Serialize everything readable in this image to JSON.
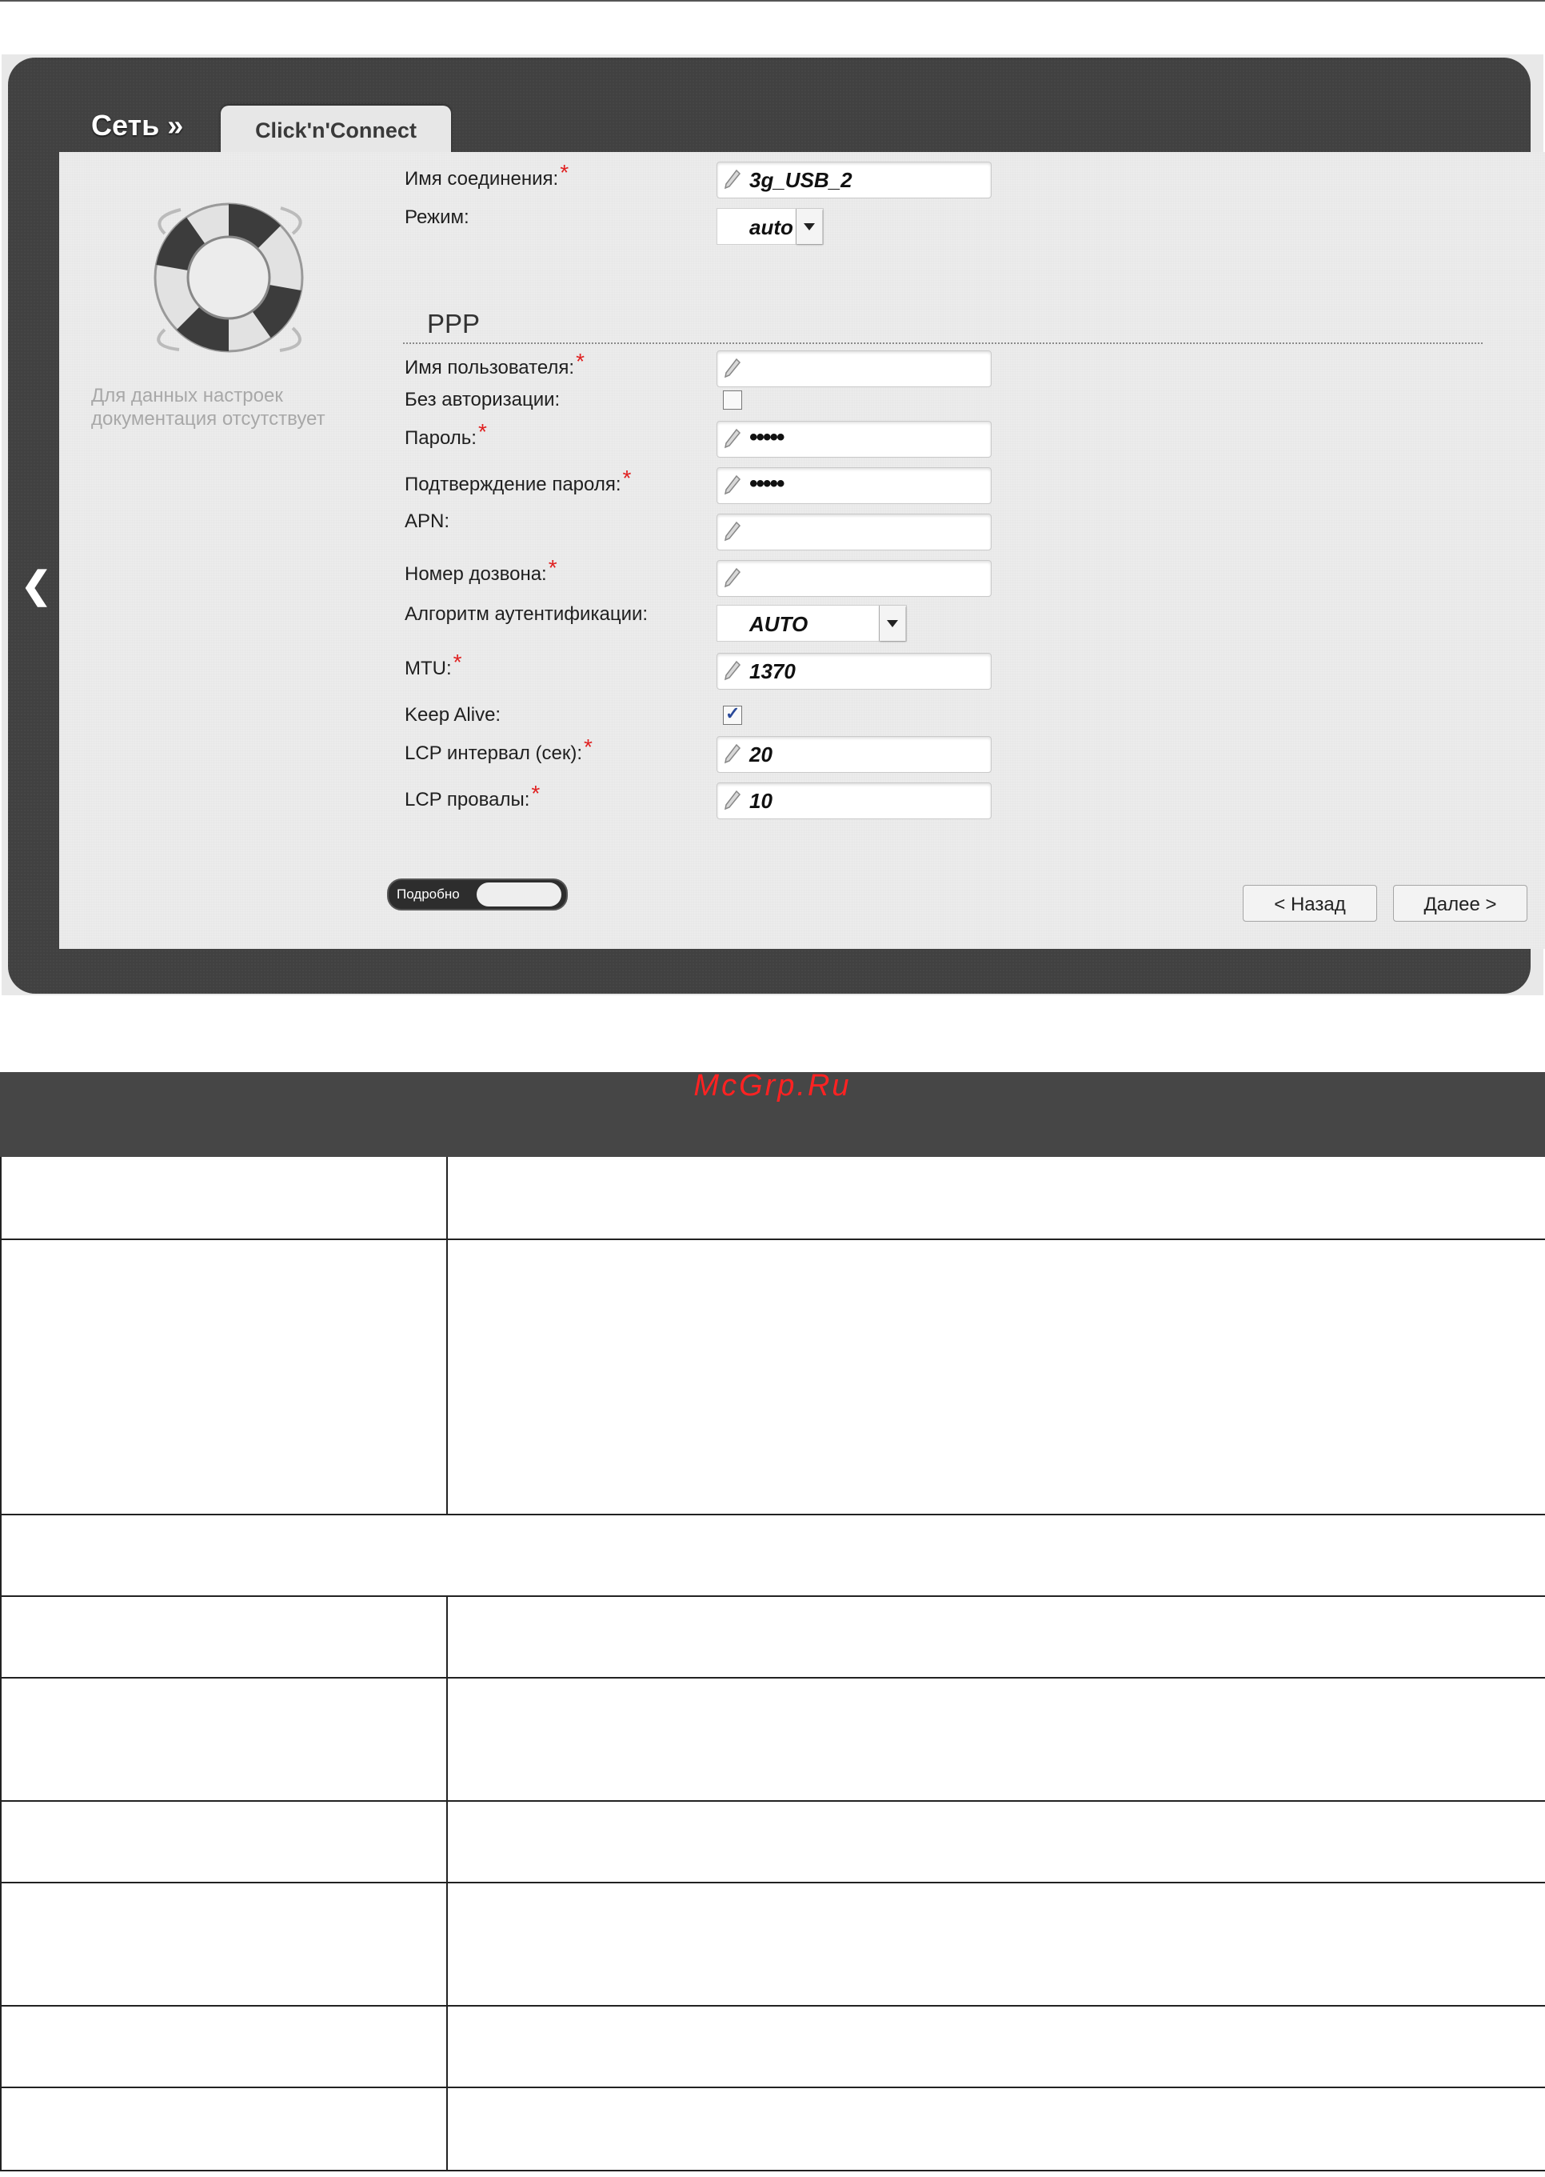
{
  "breadcrumb": "Сеть »",
  "tab_label": "Click'n'Connect",
  "side_note": "Для данных настроек документация отсутствует",
  "form": {
    "connection_name": {
      "label": "Имя соединения:",
      "value": "3g_USB_2"
    },
    "mode": {
      "label": "Режим:",
      "value": "auto"
    },
    "section_title": "PPP",
    "username": {
      "label": "Имя пользователя:",
      "value": ""
    },
    "no_auth": {
      "label": "Без авторизации:",
      "checked": false
    },
    "password": {
      "label": "Пароль:",
      "value": "•••••"
    },
    "password_confirm": {
      "label": "Подтверждение пароля:",
      "value": "•••••"
    },
    "apn": {
      "label": "APN:",
      "value": ""
    },
    "dial_number": {
      "label": "Номер дозвона:",
      "value": ""
    },
    "auth_algorithm": {
      "label": "Алгоритм аутентификации:",
      "value": "AUTO"
    },
    "mtu": {
      "label": "MTU:",
      "value": "1370"
    },
    "keep_alive": {
      "label": "Keep Alive:",
      "checked": true
    },
    "lcp_interval": {
      "label": "LCP интервал (сек):",
      "value": "20"
    },
    "lcp_failures": {
      "label": "LCP провалы:",
      "value": "10"
    },
    "required_mark": "*"
  },
  "toggle_label": "Подробно",
  "buttons": {
    "back": "< Назад",
    "next": "Далее >"
  },
  "watermark": "McGrp.Ru",
  "icons": {
    "back_arrow": "chevron-left-icon",
    "field": "pencil-icon",
    "logo": "lifebuoy-icon",
    "dropdown": "caret-down-icon"
  }
}
